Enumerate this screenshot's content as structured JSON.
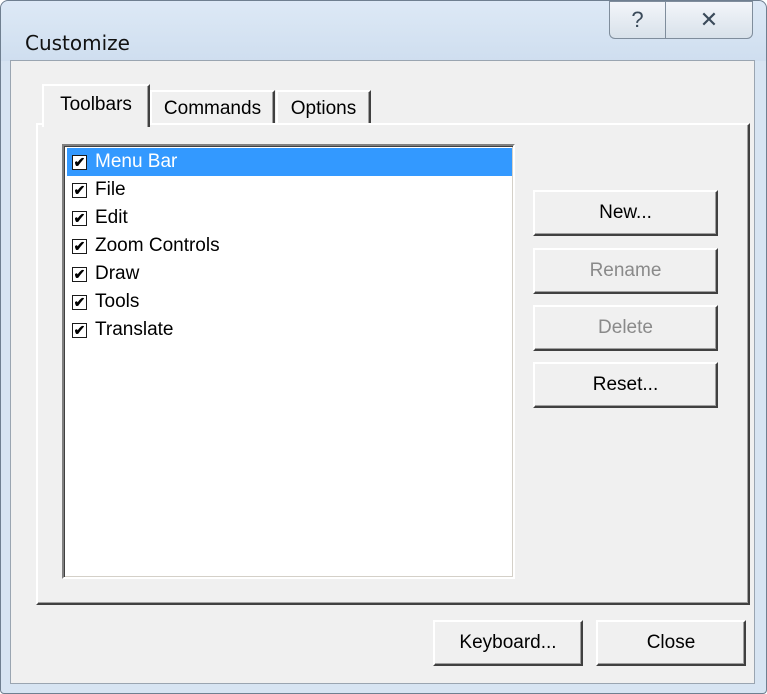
{
  "window": {
    "title": "Customize",
    "help_glyph": "?",
    "close_glyph": "✕"
  },
  "tabs": [
    {
      "label": "Toolbars",
      "active": true
    },
    {
      "label": "Commands",
      "active": false
    },
    {
      "label": "Options",
      "active": false
    }
  ],
  "toolbars_list": {
    "items": [
      {
        "label": "Menu Bar",
        "checked": true,
        "selected": true
      },
      {
        "label": "File",
        "checked": true,
        "selected": false
      },
      {
        "label": "Edit",
        "checked": true,
        "selected": false
      },
      {
        "label": "Zoom Controls",
        "checked": true,
        "selected": false
      },
      {
        "label": "Draw",
        "checked": true,
        "selected": false
      },
      {
        "label": "Tools",
        "checked": true,
        "selected": false
      },
      {
        "label": "Translate",
        "checked": true,
        "selected": false
      }
    ],
    "check_glyph": "✔"
  },
  "buttons": {
    "new": "New...",
    "rename": "Rename",
    "delete": "Delete",
    "reset": "Reset...",
    "keyboard": "Keyboard...",
    "close": "Close"
  },
  "colors": {
    "selection": "#3399ff",
    "frame": "#d7e4f2"
  },
  "icons": {
    "help": "help-icon",
    "close": "close-icon",
    "check": "checkmark-icon"
  }
}
